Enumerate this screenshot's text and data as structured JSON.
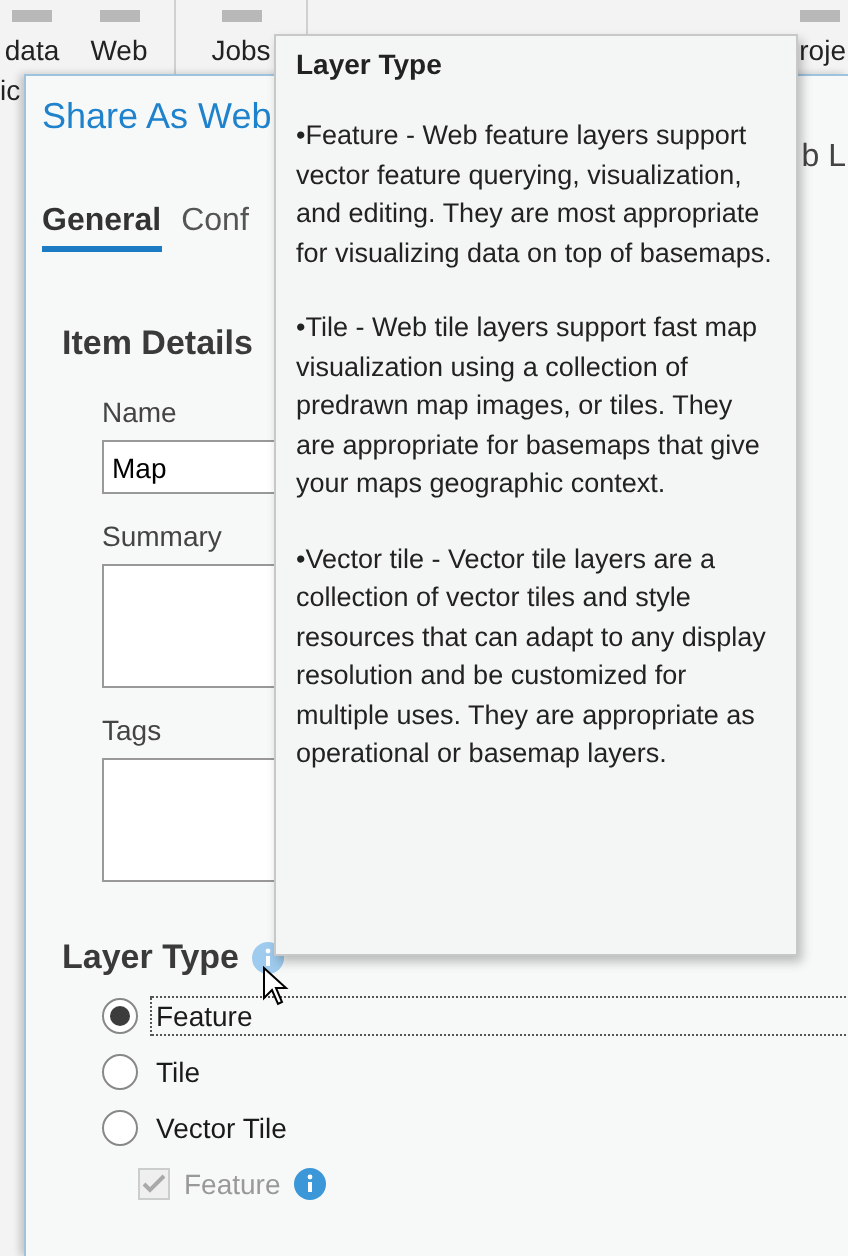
{
  "ribbon": {
    "buttons": [
      {
        "label": "data"
      },
      {
        "label": "Web"
      },
      {
        "label": "Jobs"
      },
      {
        "label": "roje"
      }
    ],
    "overflow_text": "ic"
  },
  "dialog": {
    "title": "Share As Web",
    "right_text": "b L",
    "tabs": [
      {
        "label": "General",
        "selected": true
      },
      {
        "label": "Conf",
        "selected": false
      }
    ],
    "item_details": {
      "heading": "Item Details",
      "fields": [
        {
          "label": "Name",
          "value": "Map",
          "kind": "line"
        },
        {
          "label": "Summary",
          "kind": "area"
        },
        {
          "label": "Tags",
          "kind": "area"
        }
      ]
    },
    "layer_type": {
      "heading": "Layer Type",
      "options": [
        {
          "label": "Feature",
          "selected": true,
          "focused": true
        },
        {
          "label": "Tile",
          "selected": false,
          "focused": false
        },
        {
          "label": "Vector Tile",
          "selected": false,
          "focused": false
        }
      ],
      "sub_option": {
        "label": "Feature",
        "checked": true,
        "disabled": true
      }
    }
  },
  "tooltip": {
    "title": "Layer Type",
    "paragraphs": [
      "•Feature - Web feature layers support vector feature querying, visualization, and editing. They are most appropriate for visualizing data on top of basemaps.",
      "•Tile - Web tile layers support fast map visualization using a collection of predrawn map images, or tiles. They are appropriate for basemaps that give your maps geographic context.",
      "•Vector tile - Vector tile layers are a collection of vector tiles and style resources that can adapt to any display resolution and be customized for multiple uses. They are appropriate as operational or basemap layers."
    ]
  }
}
